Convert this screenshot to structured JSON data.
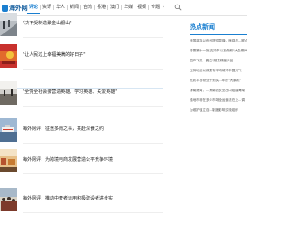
{
  "header": {
    "logo_text": "海外网",
    "nav": [
      "评论",
      "资讯",
      "华人",
      "新闻",
      "台湾",
      "香港",
      "澳门",
      "华媒",
      "视频",
      "专题"
    ],
    "active_index": 0,
    "more_glyph": "›",
    "accent_color": "#1a7fd0"
  },
  "feed": {
    "items": [
      {
        "title": "\"决不受制造聚金山银山\"",
        "thumb": "stairs"
      },
      {
        "title": "\"让人民过上幸福美满的好日子\"",
        "thumb": "poster"
      },
      {
        "title": "\"全党全社会要营造英雄、学习英雄、关爱英雄\"",
        "thumb": "hall"
      },
      {
        "title": "海外网评：征途多雨之事，共赴深食之约",
        "thumb": "ship"
      },
      {
        "title": "海外网评：为跨境电商发展营造公平竞争环境",
        "thumb": "market"
      },
      {
        "title": "海外网评：推动中奢者运用积极建设者进步实",
        "thumb": "crowd"
      }
    ]
  },
  "side": {
    "heading": "热点新闻",
    "items": [
      "美国将向以色列提供导弹，遥感与...联合...",
      "春蕾第十一批 支持阵以及特朗\"大会期间发布\"新闻宣布会",
      "国产飞机...受益\"超高精度产品...",
      "支持地区以政要有平均城市中国元气",
      "优质平台物业计划实...年的\"大鹏机\"",
      "海南港湾，...海南农农业出口组建海南",
      "强地市场在多少市场全运营法在上...调",
      "为维护独立自...制度影响交流组织"
    ]
  }
}
